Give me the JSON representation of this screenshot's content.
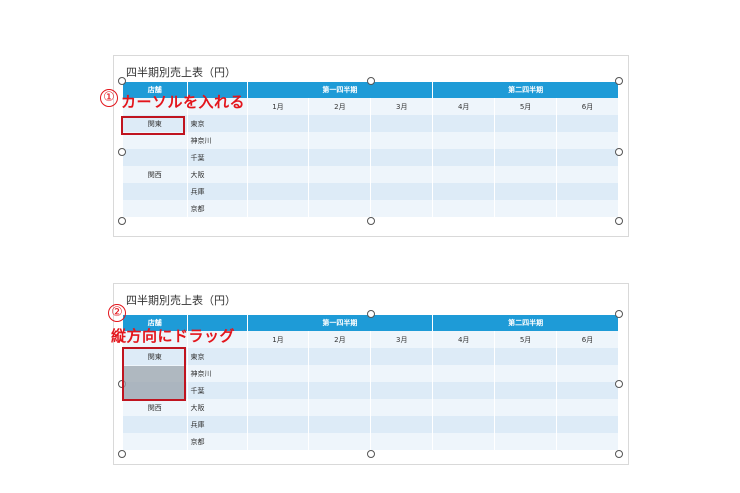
{
  "table": {
    "title": "四半期別売上表（円）",
    "header_store": "店舗",
    "q1": "第一四半期",
    "q2": "第二四半期",
    "months": [
      "1月",
      "2月",
      "3月",
      "4月",
      "5月",
      "6月"
    ],
    "rows": [
      {
        "region": "関東",
        "store": "東京"
      },
      {
        "region": "",
        "store": "神奈川"
      },
      {
        "region": "",
        "store": "千葉"
      },
      {
        "region": "関西",
        "store": "大阪"
      },
      {
        "region": "",
        "store": "兵庫"
      },
      {
        "region": "",
        "store": "京都"
      }
    ]
  },
  "step1": {
    "number": "①",
    "text": "カーソルを入れる"
  },
  "step2": {
    "number": "②",
    "text": "縦方向にドラッグ"
  },
  "colors": {
    "header": "#1e9bd7",
    "row_dark": "#ddebf7",
    "row_light": "#eef5fb",
    "highlight": "#c0141f",
    "callout": "#e3151c"
  }
}
